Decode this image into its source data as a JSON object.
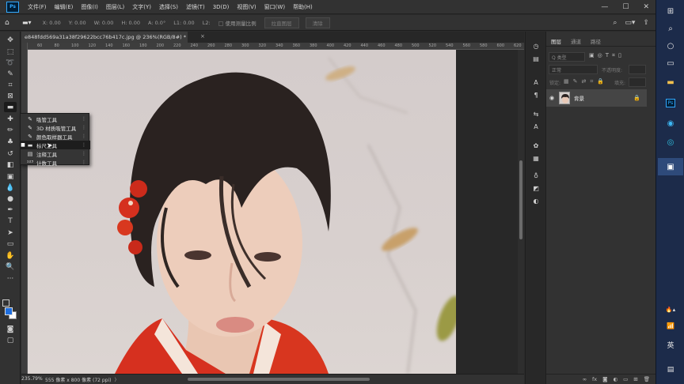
{
  "menu": {
    "logo": "Ps",
    "items": [
      "文件(F)",
      "编辑(E)",
      "图像(I)",
      "图层(L)",
      "文字(Y)",
      "选择(S)",
      "滤镜(T)",
      "3D(D)",
      "视图(V)",
      "窗口(W)",
      "帮助(H)"
    ],
    "min_icon": "minimize-icon",
    "max_icon": "maximize-icon",
    "close_icon": "close-icon"
  },
  "options": {
    "x": "X: 0.00",
    "y": "Y: 0.00",
    "w": "W: 0.00",
    "h": "H: 0.00",
    "a": "A: 0.0°",
    "l1": "L1: 0.00",
    "l2": "L2:",
    "use_measure_scale": "使用测量比例",
    "straighten": "拉直图层",
    "clear": "清除"
  },
  "document": {
    "tab_title": "e848fdd569a31a38f29622bcc76b417c.jpg @ 236%(RGB/8#) *",
    "close": "×"
  },
  "ruler_ticks": [
    "60",
    "80",
    "100",
    "120",
    "140",
    "160",
    "180",
    "200",
    "220",
    "240",
    "260",
    "280",
    "300",
    "320",
    "340",
    "360",
    "380",
    "400",
    "420",
    "440",
    "460",
    "480",
    "500",
    "520",
    "540",
    "560",
    "580",
    "600",
    "620"
  ],
  "status": {
    "zoom": "235.79%",
    "info": "555 像素 x 800 像素 (72 ppi)"
  },
  "flyout": {
    "items": [
      {
        "label": "吸管工具",
        "icon": "eyedropper-icon"
      },
      {
        "label": "3D 材质吸管工具",
        "icon": "material-eyedropper-icon"
      },
      {
        "label": "颜色取样器工具",
        "icon": "color-sampler-icon"
      },
      {
        "label": "标尺工具",
        "icon": "ruler-icon"
      },
      {
        "label": "注释工具",
        "icon": "note-icon"
      },
      {
        "label": "计数工具",
        "icon": "count-icon"
      }
    ]
  },
  "layers": {
    "tabs": [
      "图层",
      "通道",
      "路径"
    ],
    "kind": "Q 类型",
    "mode": "正常",
    "opacity": "不透明度:",
    "lock": "锁定:",
    "fill": "填充:",
    "layer_name": "背景"
  },
  "taskbar": {
    "ime": "英"
  },
  "colors": {
    "accent": "#31a8ff",
    "hover": "#1d1d1d",
    "foreground": "#1f6fe0",
    "background": "#ffffff"
  }
}
